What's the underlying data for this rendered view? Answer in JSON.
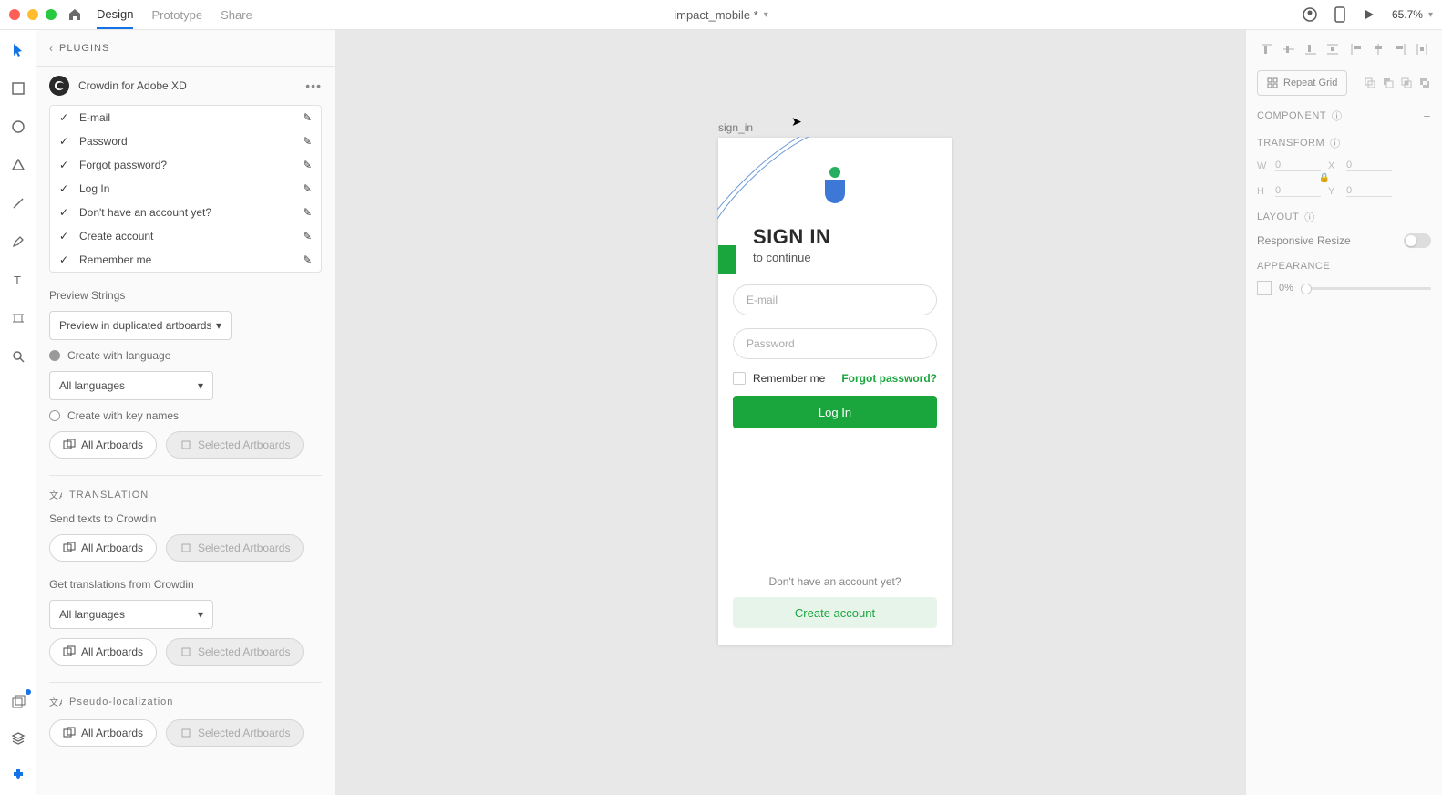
{
  "topbar": {
    "tabs": {
      "design": "Design",
      "prototype": "Prototype",
      "share": "Share"
    },
    "doc_title": "impact_mobile *",
    "zoom": "65.7%"
  },
  "toolrail": {
    "tools": [
      "select",
      "rectangle",
      "ellipse",
      "triangle",
      "line",
      "pen",
      "text",
      "artboard",
      "zoom"
    ]
  },
  "leftpanel": {
    "header": "PLUGINS",
    "plugin_name": "Crowdin for Adobe XD",
    "strings": [
      {
        "label": "E-mail"
      },
      {
        "label": "Password"
      },
      {
        "label": "Forgot password?"
      },
      {
        "label": "Log In"
      },
      {
        "label": "Don't have an account yet?"
      },
      {
        "label": "Create account"
      },
      {
        "label": "Remember me"
      }
    ],
    "preview_strings_label": "Preview Strings",
    "preview_select": "Preview in duplicated artboards",
    "create_with_language": "Create with language",
    "all_languages": "All languages",
    "create_with_key_names": "Create with key names",
    "all_artboards": "All Artboards",
    "selected_artboards": "Selected Artboards",
    "translation_header": "TRANSLATION",
    "send_texts": "Send texts to Crowdin",
    "get_translations": "Get translations from Crowdin",
    "pseudo_header": "Pseudo-localization"
  },
  "artboard": {
    "name": "sign_in",
    "title": "SIGN IN",
    "subtitle": "to continue",
    "email_placeholder": "E-mail",
    "password_placeholder": "Password",
    "remember": "Remember me",
    "forgot": "Forgot password?",
    "login": "Log In",
    "no_account": "Don't have an account yet?",
    "create": "Create account"
  },
  "rightpanel": {
    "repeat_grid": "Repeat Grid",
    "component": "COMPONENT",
    "transform": "TRANSFORM",
    "w_label": "W",
    "w_val": "0",
    "h_label": "H",
    "h_val": "0",
    "x_label": "X",
    "x_val": "0",
    "y_label": "Y",
    "y_val": "0",
    "layout": "LAYOUT",
    "responsive": "Responsive Resize",
    "appearance": "APPEARANCE",
    "opacity": "0%"
  }
}
